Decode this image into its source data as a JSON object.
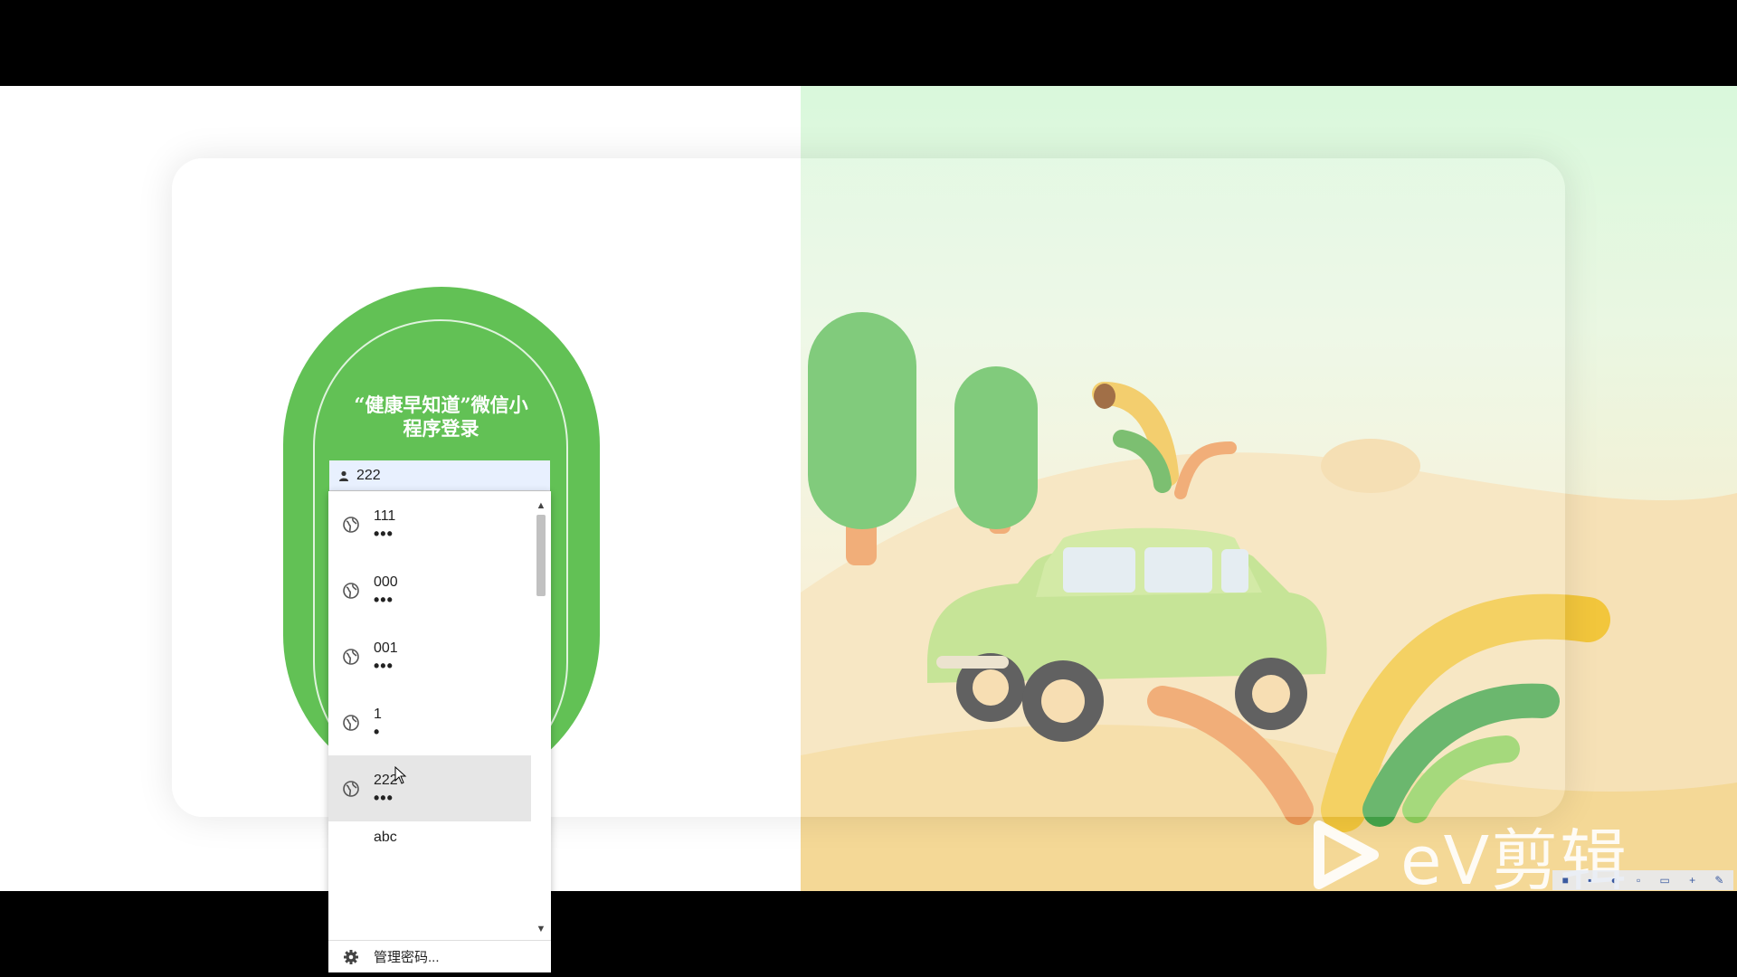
{
  "login": {
    "title": "“健康早知道”微信小程序登录",
    "username_value": "222"
  },
  "autofill": {
    "items": [
      {
        "username": "111",
        "password_mask": "•••"
      },
      {
        "username": "000",
        "password_mask": "•••"
      },
      {
        "username": "001",
        "password_mask": "•••"
      },
      {
        "username": "1",
        "password_mask": "•"
      },
      {
        "username": "222",
        "password_mask": "•••"
      },
      {
        "username": "abc",
        "password_mask": ""
      }
    ],
    "hovered_index": 4,
    "manage_label": "管理密码..."
  },
  "watermark": {
    "brand": "eV剪辑"
  },
  "colors": {
    "accent_green": "#62c155",
    "field_bg": "#e8f0fe",
    "hover_bg": "#e6e6e6"
  },
  "icons": {
    "user": "user-icon",
    "globe": "globe-icon",
    "gear": "gear-icon",
    "cursor": "cursor-icon"
  }
}
